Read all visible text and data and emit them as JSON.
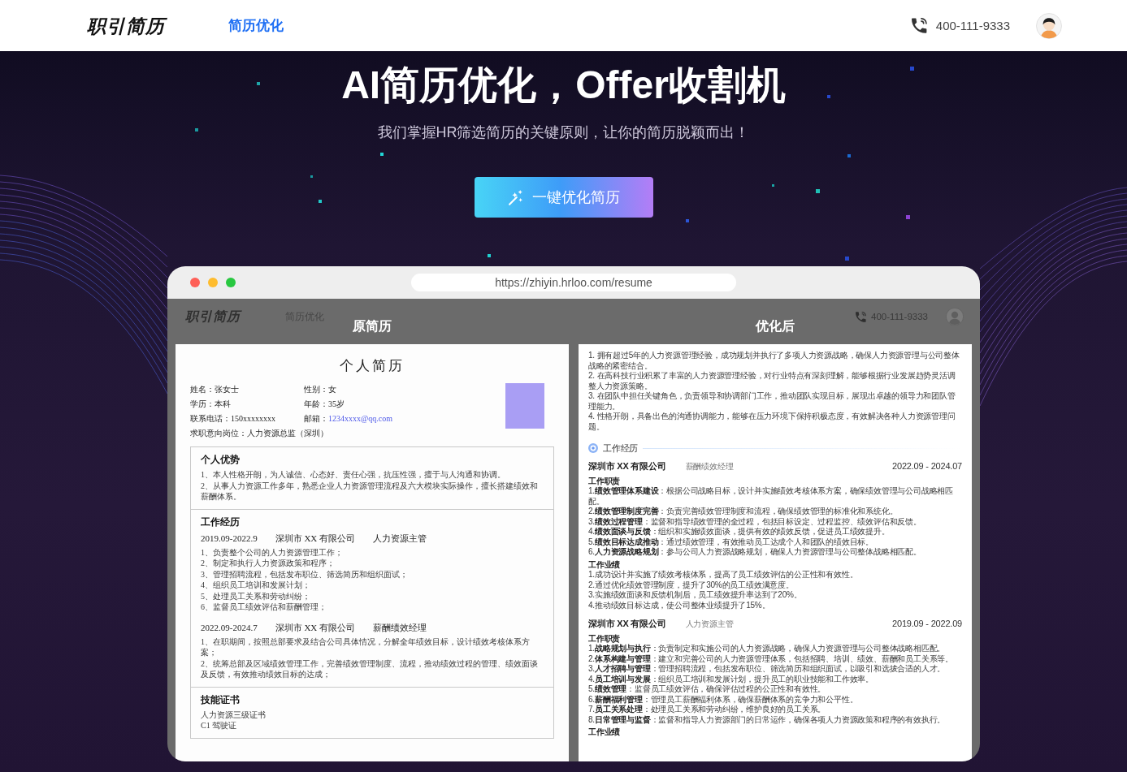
{
  "nav": {
    "logo": "职引简历",
    "links": [
      {
        "label": "简历优化",
        "selected": true
      }
    ],
    "phone": "400-111-9333"
  },
  "hero": {
    "title": "AI简历优化，Offer收割机",
    "subtitle": "我们掌握HR筛选简历的关键原则，让你的简历脱颖而出！",
    "button": "一键优化简历"
  },
  "browser": {
    "url": "https://zhiyin.hrloo.com/resume",
    "page_header": {
      "logo": "职引简历",
      "link": "简历优化",
      "phone": "400-111-9333"
    }
  },
  "original_resume": {
    "label": "原简历",
    "title": "个人简历",
    "fields": [
      {
        "label": "姓名：",
        "value": "张女士",
        "kind": "text"
      },
      {
        "label": "性别：",
        "value": "女",
        "kind": "text"
      },
      {
        "label": "学历：",
        "value": "本科",
        "kind": "text"
      },
      {
        "label": "年龄：",
        "value": "35岁",
        "kind": "text"
      },
      {
        "label": "联系电话：",
        "value": "150xxxxxxxx",
        "kind": "text"
      },
      {
        "label": "邮箱：",
        "value": "1234xxxx@qq.com",
        "kind": "email"
      },
      {
        "label": "求职意向岗位：",
        "value": "人力资源总监（深圳）",
        "kind": "wide"
      }
    ],
    "sections": [
      {
        "kind": "list",
        "heading": "个人优势",
        "items": [
          "1、本人性格开朗，为人诚信、心态好、责任心强，抗压性强，擅于与人沟通和协调。",
          "2、从事人力资源工作多年，熟悉企业人力资源管理流程及六大模块实际操作，擅长搭建绩效和薪酬体系。"
        ]
      },
      {
        "kind": "jobs",
        "heading": "工作经历",
        "jobs": [
          {
            "period": "2019.09-2022.9",
            "company": "深圳市 XX 有限公司",
            "title": "人力资源主管",
            "items": [
              "1、负责整个公司的人力资源管理工作；",
              "2、制定和执行人力资源政策和程序；",
              "3、管理招聘流程，包括发布职位、筛选简历和组织面试；",
              "4、组织员工培训和发展计划；",
              "5、处理员工关系和劳动纠纷；",
              "6、监督员工绩效评估和薪酬管理；"
            ]
          },
          {
            "period": "2022.09-2024.7",
            "company": "深圳市 XX 有限公司",
            "title": "薪酬绩效经理",
            "items": [
              "1、在职期间，按照总部要求及结合公司具体情况，分解全年绩效目标，设计绩效考核体系方案；",
              "2、统筹总部及区域绩效管理工作，完善绩效管理制度、流程，推动绩效过程的管理、绩效面谈及反馈，有效推动绩效目标的达成；"
            ]
          }
        ]
      },
      {
        "kind": "list",
        "heading": "技能证书",
        "items": [
          "人力资源三级证书",
          "C1 驾驶证"
        ]
      }
    ]
  },
  "optimized_resume": {
    "label": "优化后",
    "advantages": [
      "1. 拥有超过5年的人力资源管理经验，成功规划并执行了多项人力资源战略，确保人力资源管理与公司整体战略的紧密结合。",
      "2. 在高科技行业积累了丰富的人力资源管理经验，对行业特点有深刻理解，能够根据行业发展趋势灵活调整人力资源策略。",
      "3. 在团队中担任关键角色，负责领导和协调部门工作，推动团队实现目标，展现出卓越的领导力和团队管理能力。",
      "4. 性格开朗，具备出色的沟通协调能力，能够在压力环境下保持积极态度，有效解决各种人力资源管理问题。"
    ],
    "section": "工作经历",
    "jobs": [
      {
        "company": "深圳市 XX 有限公司",
        "title": "薪酬绩效经理",
        "period": "2022.09 - 2024.07",
        "groups": [
          {
            "heading": "工作职责",
            "items": [
              "1.**绩效管理体系建设**：根据公司战略目标，设计并实施绩效考核体系方案，确保绩效管理与公司战略相匹配。",
              "2.**绩效管理制度完善**：负责完善绩效管理制度和流程，确保绩效管理的标准化和系统化。",
              "3.**绩效过程管理**：监督和指导绩效管理的全过程，包括目标设定、过程监控、绩效评估和反馈。",
              "4.**绩效面谈与反馈**：组织和实施绩效面谈，提供有效的绩效反馈，促进员工绩效提升。",
              "5.**绩效目标达成推动**：通过绩效管理，有效推动员工达成个人和团队的绩效目标。",
              "6.**人力资源战略规划**：参与公司人力资源战略规划，确保人力资源管理与公司整体战略相匹配。"
            ]
          },
          {
            "heading": "工作业绩",
            "items": [
              "1.成功设计并实施了绩效考核体系，提高了员工绩效评估的公正性和有效性。",
              "2.通过优化绩效管理制度，提升了30%的员工绩效满意度。",
              "3.实施绩效面谈和反馈机制后，员工绩效提升率达到了20%。",
              "4.推动绩效目标达成，使公司整体业绩提升了15%。"
            ]
          }
        ]
      },
      {
        "company": "深圳市 XX 有限公司",
        "title": "人力资源主管",
        "period": "2019.09 - 2022.09",
        "groups": [
          {
            "heading": "工作职责",
            "items": [
              "1.**战略规划与执行**：负责制定和实施公司的人力资源战略，确保人力资源管理与公司整体战略相匹配。",
              "2.**体系构建与管理**：建立和完善公司的人力资源管理体系，包括招聘、培训、绩效、薪酬和员工关系等。",
              "3.**人才招聘与管理**：管理招聘流程，包括发布职位、筛选简历和组织面试，以吸引和选拔合适的人才。",
              "4.**员工培训与发展**：组织员工培训和发展计划，提升员工的职业技能和工作效率。",
              "5.**绩效管理**：监督员工绩效评估，确保评估过程的公正性和有效性。",
              "6.**薪酬福利管理**：管理员工薪酬福利体系，确保薪酬体系的竞争力和公平性。",
              "7.**员工关系处理**：处理员工关系和劳动纠纷，维护良好的员工关系。",
              "8.**日常管理与监督**：监督和指导人力资源部门的日常运作，确保各项人力资源政策和程序的有效执行。"
            ]
          },
          {
            "heading": "工作业绩"
          }
        ]
      }
    ]
  }
}
